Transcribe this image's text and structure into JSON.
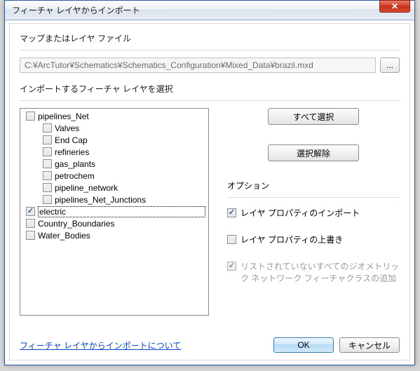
{
  "window": {
    "title": "フィーチャ レイヤからインポート"
  },
  "map_section": {
    "label": "マップまたはレイヤ ファイル",
    "path": "C:¥ArcTutor¥Schematics¥Schematics_Configuration¥Mixed_Data¥brazil.mxd",
    "browse": "..."
  },
  "layers_section": {
    "label": "インポートするフィーチャ レイヤを選択",
    "items": [
      {
        "label": "pipelines_Net",
        "indent": 0,
        "checked": false,
        "selected": false
      },
      {
        "label": "Valves",
        "indent": 1,
        "checked": false,
        "selected": false
      },
      {
        "label": "End Cap",
        "indent": 1,
        "checked": false,
        "selected": false
      },
      {
        "label": "refineries",
        "indent": 1,
        "checked": false,
        "selected": false
      },
      {
        "label": "gas_plants",
        "indent": 1,
        "checked": false,
        "selected": false
      },
      {
        "label": "petrochem",
        "indent": 1,
        "checked": false,
        "selected": false
      },
      {
        "label": "pipeline_network",
        "indent": 1,
        "checked": false,
        "selected": false
      },
      {
        "label": "pipelines_Net_Junctions",
        "indent": 1,
        "checked": false,
        "selected": false
      },
      {
        "label": "electric",
        "indent": 0,
        "checked": true,
        "selected": true
      },
      {
        "label": "Country_Boundaries",
        "indent": 0,
        "checked": false,
        "selected": false
      },
      {
        "label": "Water_Bodies",
        "indent": 0,
        "checked": false,
        "selected": false
      }
    ]
  },
  "buttons": {
    "select_all": "すべて選択",
    "deselect": "選択解除"
  },
  "options": {
    "label": "オプション",
    "import_props": {
      "label": "レイヤ プロパティのインポート",
      "checked": true,
      "disabled": false
    },
    "overwrite_props": {
      "label": "レイヤ プロパティの上書き",
      "checked": false,
      "disabled": false
    },
    "add_unlisted": {
      "label": "リストされていないすべてのジオメトリック ネットワーク フィーチャクラスの追加",
      "checked": true,
      "disabled": true
    }
  },
  "footer": {
    "help": "フィーチャ レイヤからインポートについて",
    "ok": "OK",
    "cancel": "キャンセル"
  }
}
